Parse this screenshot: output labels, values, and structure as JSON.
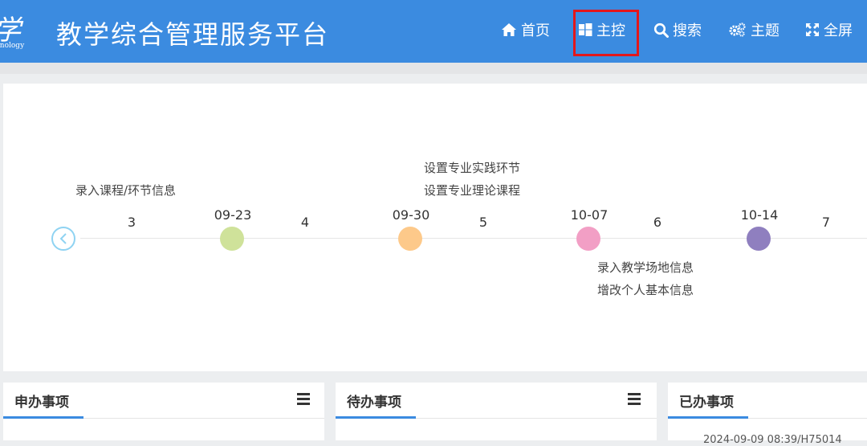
{
  "header": {
    "logo_glyph": "学",
    "logo_sub": "hnology",
    "title": "教学综合管理服务平台",
    "nav": [
      {
        "label": "首页",
        "icon": "home-icon"
      },
      {
        "label": "主控",
        "icon": "windows-icon"
      },
      {
        "label": "搜索",
        "icon": "search-icon"
      },
      {
        "label": "主题",
        "icon": "cogs-icon"
      },
      {
        "label": "全屏",
        "icon": "expand-icon"
      }
    ],
    "accent": "#3b8be0",
    "highlight_color": "#e3171b"
  },
  "timeline": {
    "weeks": [
      "3",
      "4",
      "5",
      "6",
      "7"
    ],
    "dates": [
      {
        "label": "09-23",
        "color": "#cfe29a"
      },
      {
        "label": "09-30",
        "color": "#fdc98a"
      },
      {
        "label": "10-07",
        "color": "#f29fc5"
      },
      {
        "label": "10-14",
        "color": "#8f7fbf"
      }
    ],
    "notes": {
      "above_week3": "录入课程/环节信息",
      "above_0930_1": "设置专业实践环节",
      "above_0930_2": "设置专业理论课程",
      "below_1007_1": "录入教学场地信息",
      "below_1007_2": "增改个人基本信息"
    }
  },
  "panels": [
    {
      "title": "申办事项",
      "has_menu": true
    },
    {
      "title": "待办事项",
      "has_menu": true
    },
    {
      "title": "已办事项",
      "has_menu": false,
      "snippet": "2024-09-09 08:39/H75014"
    }
  ]
}
